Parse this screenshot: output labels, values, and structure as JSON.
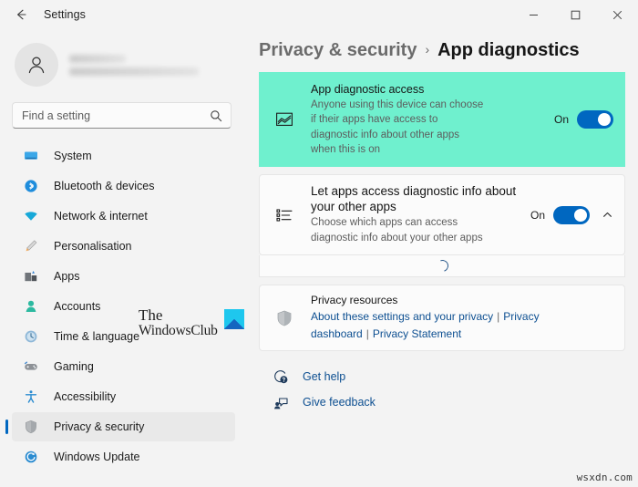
{
  "window": {
    "title": "Settings",
    "back_icon": "back-arrow-icon",
    "minimize_label": "Minimise",
    "maximize_label": "Maximise",
    "close_label": "Close"
  },
  "sidebar": {
    "account": {
      "name_redacted": "",
      "email_redacted": ""
    },
    "search": {
      "placeholder": "Find a setting",
      "value": ""
    },
    "items": [
      {
        "label": "System",
        "icon": "monitor-icon",
        "selected": false
      },
      {
        "label": "Bluetooth & devices",
        "icon": "bluetooth-icon",
        "selected": false
      },
      {
        "label": "Network & internet",
        "icon": "wifi-icon",
        "selected": false
      },
      {
        "label": "Personalisation",
        "icon": "brush-icon",
        "selected": false
      },
      {
        "label": "Apps",
        "icon": "apps-icon",
        "selected": false
      },
      {
        "label": "Accounts",
        "icon": "person-icon",
        "selected": false
      },
      {
        "label": "Time & language",
        "icon": "clock-icon",
        "selected": false
      },
      {
        "label": "Gaming",
        "icon": "gamepad-icon",
        "selected": false
      },
      {
        "label": "Accessibility",
        "icon": "accessibility-icon",
        "selected": false
      },
      {
        "label": "Privacy & security",
        "icon": "shield-icon",
        "selected": true
      },
      {
        "label": "Windows Update",
        "icon": "update-icon",
        "selected": false
      }
    ]
  },
  "watermark": {
    "line1": "The",
    "line2": "WindowsClub",
    "site": "wsxdn.com"
  },
  "main": {
    "breadcrumb": {
      "parent": "Privacy & security",
      "separator": "›",
      "current": "App diagnostics"
    },
    "settings": [
      {
        "id": "app-diagnostic-access",
        "icon": "chart-icon",
        "title": "App diagnostic access",
        "description": "Anyone using this device can choose if their apps have access to diagnostic info about other apps when this is on",
        "toggle_label": "On",
        "toggle_state": "on",
        "highlighted": true,
        "highlight_color": "#6ff0ce",
        "has_chevron": false
      },
      {
        "id": "let-apps-access-diagnostic-info",
        "icon": "list-icon",
        "title": "Let apps access diagnostic info about your other apps",
        "description": "Choose which apps can access diagnostic info about your other apps",
        "toggle_label": "On",
        "toggle_state": "on",
        "highlighted": false,
        "has_chevron": true,
        "chevron_icon": "chevron-up-icon"
      }
    ],
    "loading": {
      "icon": "loading-spinner",
      "label": ""
    },
    "privacy_resources": {
      "icon": "shield-icon",
      "title": "Privacy resources",
      "links": [
        "About these settings and your privacy",
        "Privacy dashboard",
        "Privacy Statement"
      ],
      "separator": "|"
    },
    "footer_links": [
      {
        "label": "Get help",
        "icon": "help-icon"
      },
      {
        "label": "Give feedback",
        "icon": "feedback-icon"
      }
    ]
  },
  "colors": {
    "accent": "#0067c0",
    "highlight": "#6ff0ce",
    "link": "#0d4f91",
    "page_background": "#f3f3f3"
  }
}
